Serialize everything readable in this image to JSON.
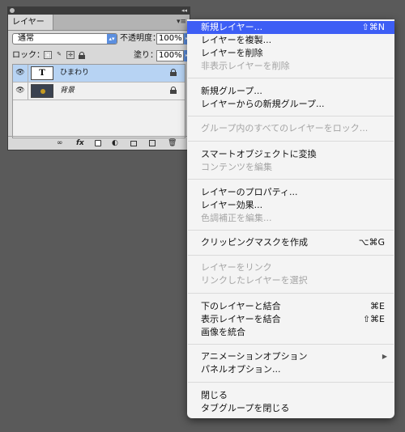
{
  "panel": {
    "tab_label": "レイヤー",
    "blend_mode": "通常",
    "opacity_label": "不透明度：",
    "opacity_value": "100%",
    "lock_label": "ロック：",
    "fill_label": "塗り：",
    "fill_value": "100%",
    "layers": [
      {
        "name": "ひまわり",
        "thumb_text": "T",
        "selected": true
      },
      {
        "name": "背景",
        "selected": false
      }
    ],
    "bottom_icons": [
      "link-icon",
      "fx-icon",
      "mask-icon",
      "adjustment-icon",
      "folder-icon",
      "new-layer-icon",
      "trash-icon"
    ],
    "fx_text": "fx"
  },
  "menu": {
    "items": [
      {
        "label": "新規レイヤー...",
        "shortcut": "⇧⌘N",
        "state": "highlight"
      },
      {
        "label": "レイヤーを複製...",
        "state": "enabled"
      },
      {
        "label": "レイヤーを削除",
        "state": "enabled"
      },
      {
        "label": "非表示レイヤーを削除",
        "state": "disabled"
      },
      {
        "label": "新規グループ...",
        "state": "enabled"
      },
      {
        "label": "レイヤーからの新規グループ...",
        "state": "enabled"
      },
      {
        "label": "グループ内のすべてのレイヤーをロック...",
        "state": "disabled"
      },
      {
        "label": "スマートオブジェクトに変換",
        "state": "enabled"
      },
      {
        "label": "コンテンツを編集",
        "state": "disabled"
      },
      {
        "label": "レイヤーのプロパティ...",
        "state": "enabled"
      },
      {
        "label": "レイヤー効果...",
        "state": "enabled"
      },
      {
        "label": "色調補正を編集...",
        "state": "disabled"
      },
      {
        "label": "クリッピングマスクを作成",
        "shortcut": "⌥⌘G",
        "state": "enabled"
      },
      {
        "label": "レイヤーをリンク",
        "state": "disabled"
      },
      {
        "label": "リンクしたレイヤーを選択",
        "state": "disabled"
      },
      {
        "label": "下のレイヤーと結合",
        "shortcut": "⌘E",
        "state": "enabled"
      },
      {
        "label": "表示レイヤーを結合",
        "shortcut": "⇧⌘E",
        "state": "enabled"
      },
      {
        "label": "画像を統合",
        "state": "enabled"
      },
      {
        "label": "アニメーションオプション",
        "state": "enabled",
        "submenu": true
      },
      {
        "label": "パネルオプション...",
        "state": "enabled"
      },
      {
        "label": "閉じる",
        "state": "enabled"
      },
      {
        "label": "タブグループを閉じる",
        "state": "enabled"
      }
    ]
  },
  "colors": {
    "desktop": "#5a5a5a",
    "menu_highlight": "#3d5ef5",
    "layer_selected": "#b7d3f3"
  }
}
